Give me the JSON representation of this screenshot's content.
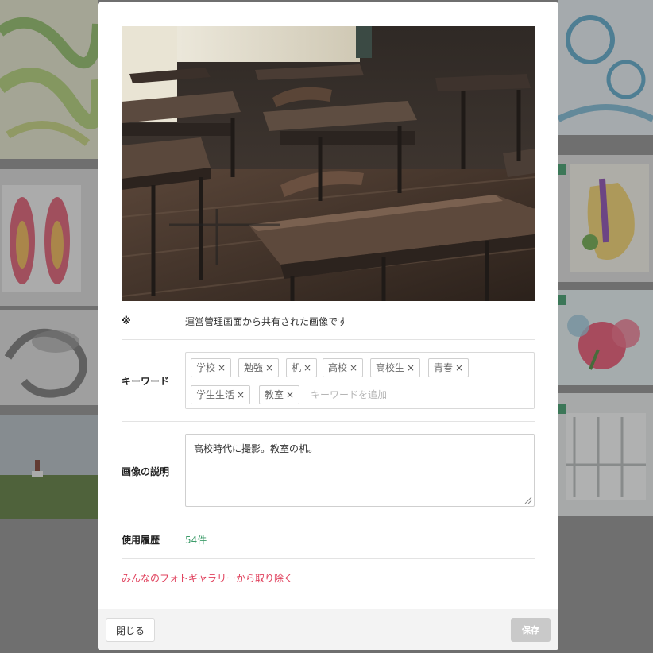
{
  "image_alt": "教室の机",
  "notice": {
    "label": "※",
    "text": "運営管理画面から共有された画像です"
  },
  "keywords": {
    "label": "キーワード",
    "tags": [
      "学校",
      "勉強",
      "机",
      "高校",
      "高校生",
      "青春",
      "学生生活",
      "教室"
    ],
    "remove_glyph": "×",
    "input_placeholder": "キーワードを追加"
  },
  "description": {
    "label": "画像の説明",
    "value": "高校時代に撮影。教室の机。"
  },
  "usage": {
    "label": "使用履歴",
    "count_text": "54件"
  },
  "remove_link": "みんなのフォトギャラリーから取り除く",
  "footer": {
    "close_label": "閉じる",
    "save_label": "保存"
  },
  "colors": {
    "accent_green": "#3d9c6a",
    "danger_pink": "#e0405c",
    "save_disabled": "#c9c9c9"
  }
}
